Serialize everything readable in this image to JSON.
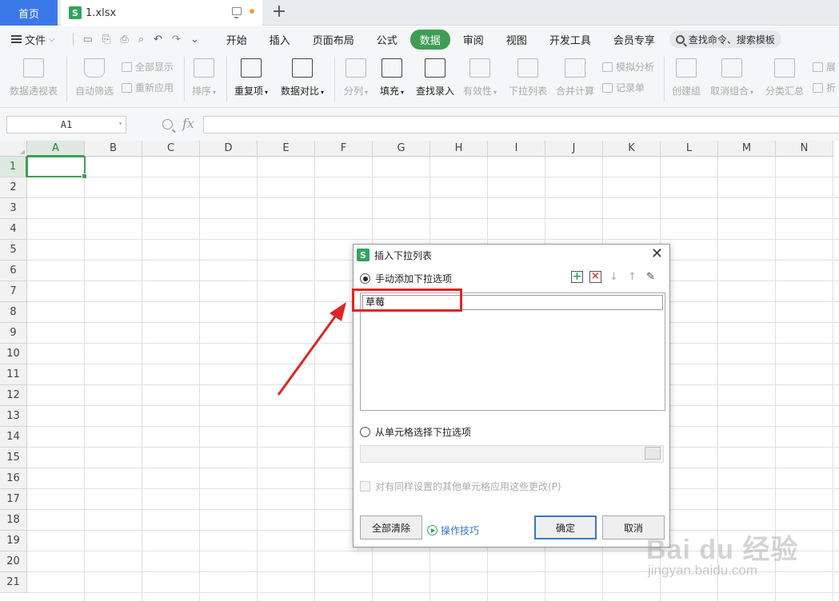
{
  "tabs": {
    "home": "首页",
    "file": "1.xlsx",
    "sheet_logo": "S"
  },
  "menu": {
    "file_label": "文件",
    "tabs": [
      "开始",
      "插入",
      "页面布局",
      "公式",
      "数据",
      "审阅",
      "视图",
      "开发工具",
      "会员专享"
    ],
    "active_tab": "数据",
    "search_placeholder": "查找命令、搜索模板"
  },
  "ribbon": {
    "pivot": "数据透视表",
    "autofilter": "自动筛选",
    "show_all": "全部显示",
    "reapply": "重新应用",
    "sort": "排序",
    "duplicates": "重复项",
    "compare": "数据对比",
    "split": "分列",
    "fill": "填充",
    "find_entry": "查找录入",
    "validity": "有效性",
    "dropdown": "下拉列表",
    "consolidate": "合并计算",
    "simulate": "模拟分析",
    "record": "记录单",
    "group": "创建组",
    "ungroup": "取消组合",
    "subtotal": "分类汇总",
    "expand": "展",
    "fold": "折"
  },
  "formula_bar": {
    "cell_ref": "A1",
    "fx": "fx",
    "formula": ""
  },
  "grid": {
    "columns": [
      "A",
      "B",
      "C",
      "D",
      "E",
      "F",
      "G",
      "H",
      "I",
      "J",
      "K",
      "L",
      "M",
      "N"
    ],
    "rows": [
      "1",
      "2",
      "3",
      "4",
      "5",
      "6",
      "7",
      "8",
      "9",
      "10",
      "11",
      "12",
      "13",
      "14",
      "15",
      "16",
      "17",
      "18",
      "19",
      "20",
      "21"
    ],
    "selected_column": "A",
    "selected_row": "1"
  },
  "dialog": {
    "title": "插入下拉列表",
    "option_manual": "手动添加下拉选项",
    "items": [
      "草莓"
    ],
    "option_from_cells": "从单元格选择下拉选项",
    "range_value": "",
    "apply_others": "对有同样设置的其他单元格应用这些更改(P)",
    "clear_all": "全部清除",
    "tips": "操作技巧",
    "ok": "确定",
    "cancel": "取消",
    "manual_selected": true,
    "apply_others_checked": false
  },
  "watermark": {
    "logo": "Bai du 经验",
    "url": "jingyan.baidu.com"
  },
  "colors": {
    "accent_green": "#3e9d55",
    "tab_blue": "#3b78e7",
    "annotation_red": "#e02424"
  }
}
